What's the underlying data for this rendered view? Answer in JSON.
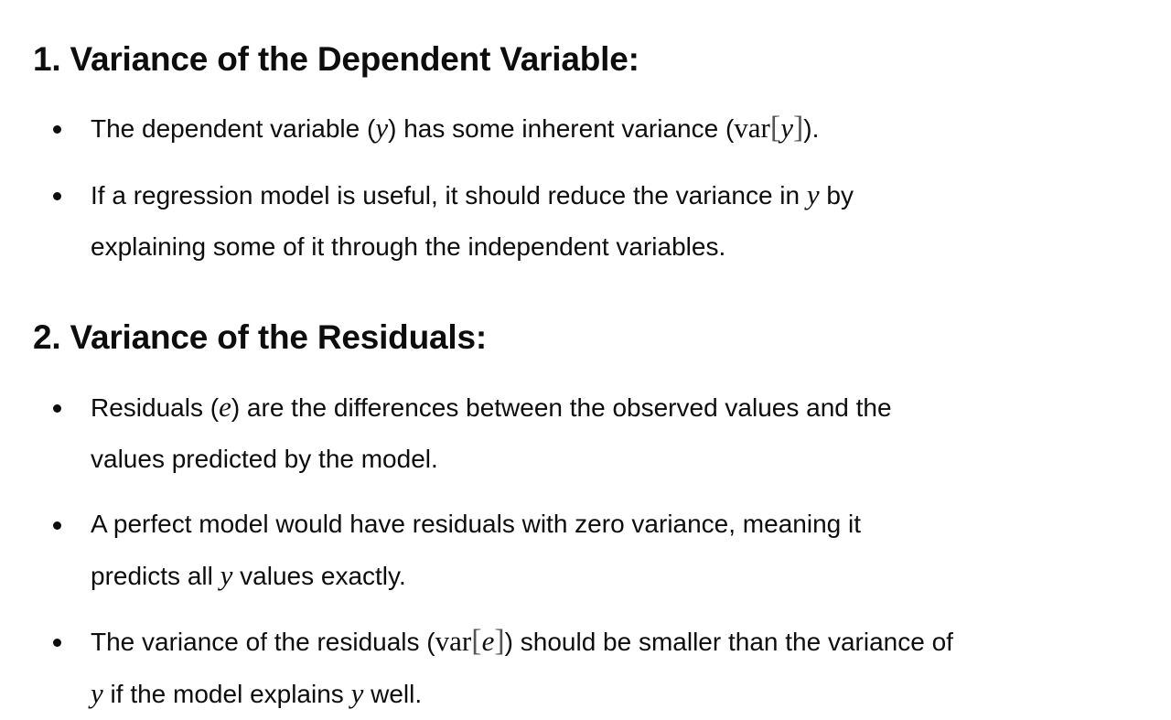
{
  "section1": {
    "heading": "1. Variance of the Dependent Variable:",
    "bullet1": {
      "before": "The dependent variable (",
      "var": "y",
      "mid": ") has some inherent variance (",
      "fn": "var",
      "arg": "y",
      "after": ")."
    },
    "bullet2": {
      "line1_before": "If a regression model is useful, it should reduce the variance in ",
      "var": "y",
      "line1_after": " by",
      "line2": "explaining some of it through the independent variables."
    }
  },
  "section2": {
    "heading": "2. Variance of the Residuals:",
    "bullet1": {
      "before": "Residuals (",
      "var": "e",
      "after": ") are the differences between the observed values and the",
      "line2": "values predicted by the model."
    },
    "bullet2": {
      "line1": "A perfect model would have residuals with zero variance, meaning it",
      "line2_before": "predicts all ",
      "var": "y",
      "line2_after": " values exactly."
    },
    "bullet3": {
      "before": "The variance of the residuals (",
      "fn": "var",
      "arg": "e",
      "after": ") should be smaller than the variance of",
      "line2_var1": "y",
      "line2_mid": " if the model explains ",
      "line2_var2": "y",
      "line2_after": " well."
    }
  }
}
